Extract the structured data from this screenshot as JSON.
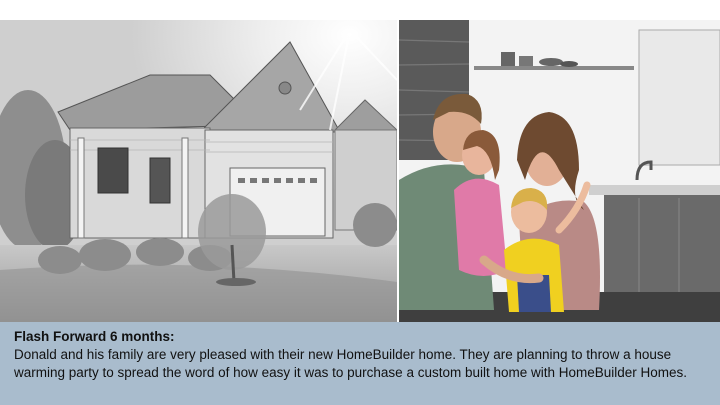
{
  "slide": {
    "caption_title": "Flash Forward 6 months:",
    "caption_body": "Donald and his family are very pleased with their new HomeBuilder home.  They are planning to throw a house warming party to spread the word of how easy it was to purchase a custom built home with HomeBuilder Homes."
  },
  "illustrations": {
    "left": "house-sketch",
    "right": "family-kitchen-sketch"
  },
  "colors": {
    "caption_background": "#a9bccd",
    "slide_background": "#ffffff"
  }
}
